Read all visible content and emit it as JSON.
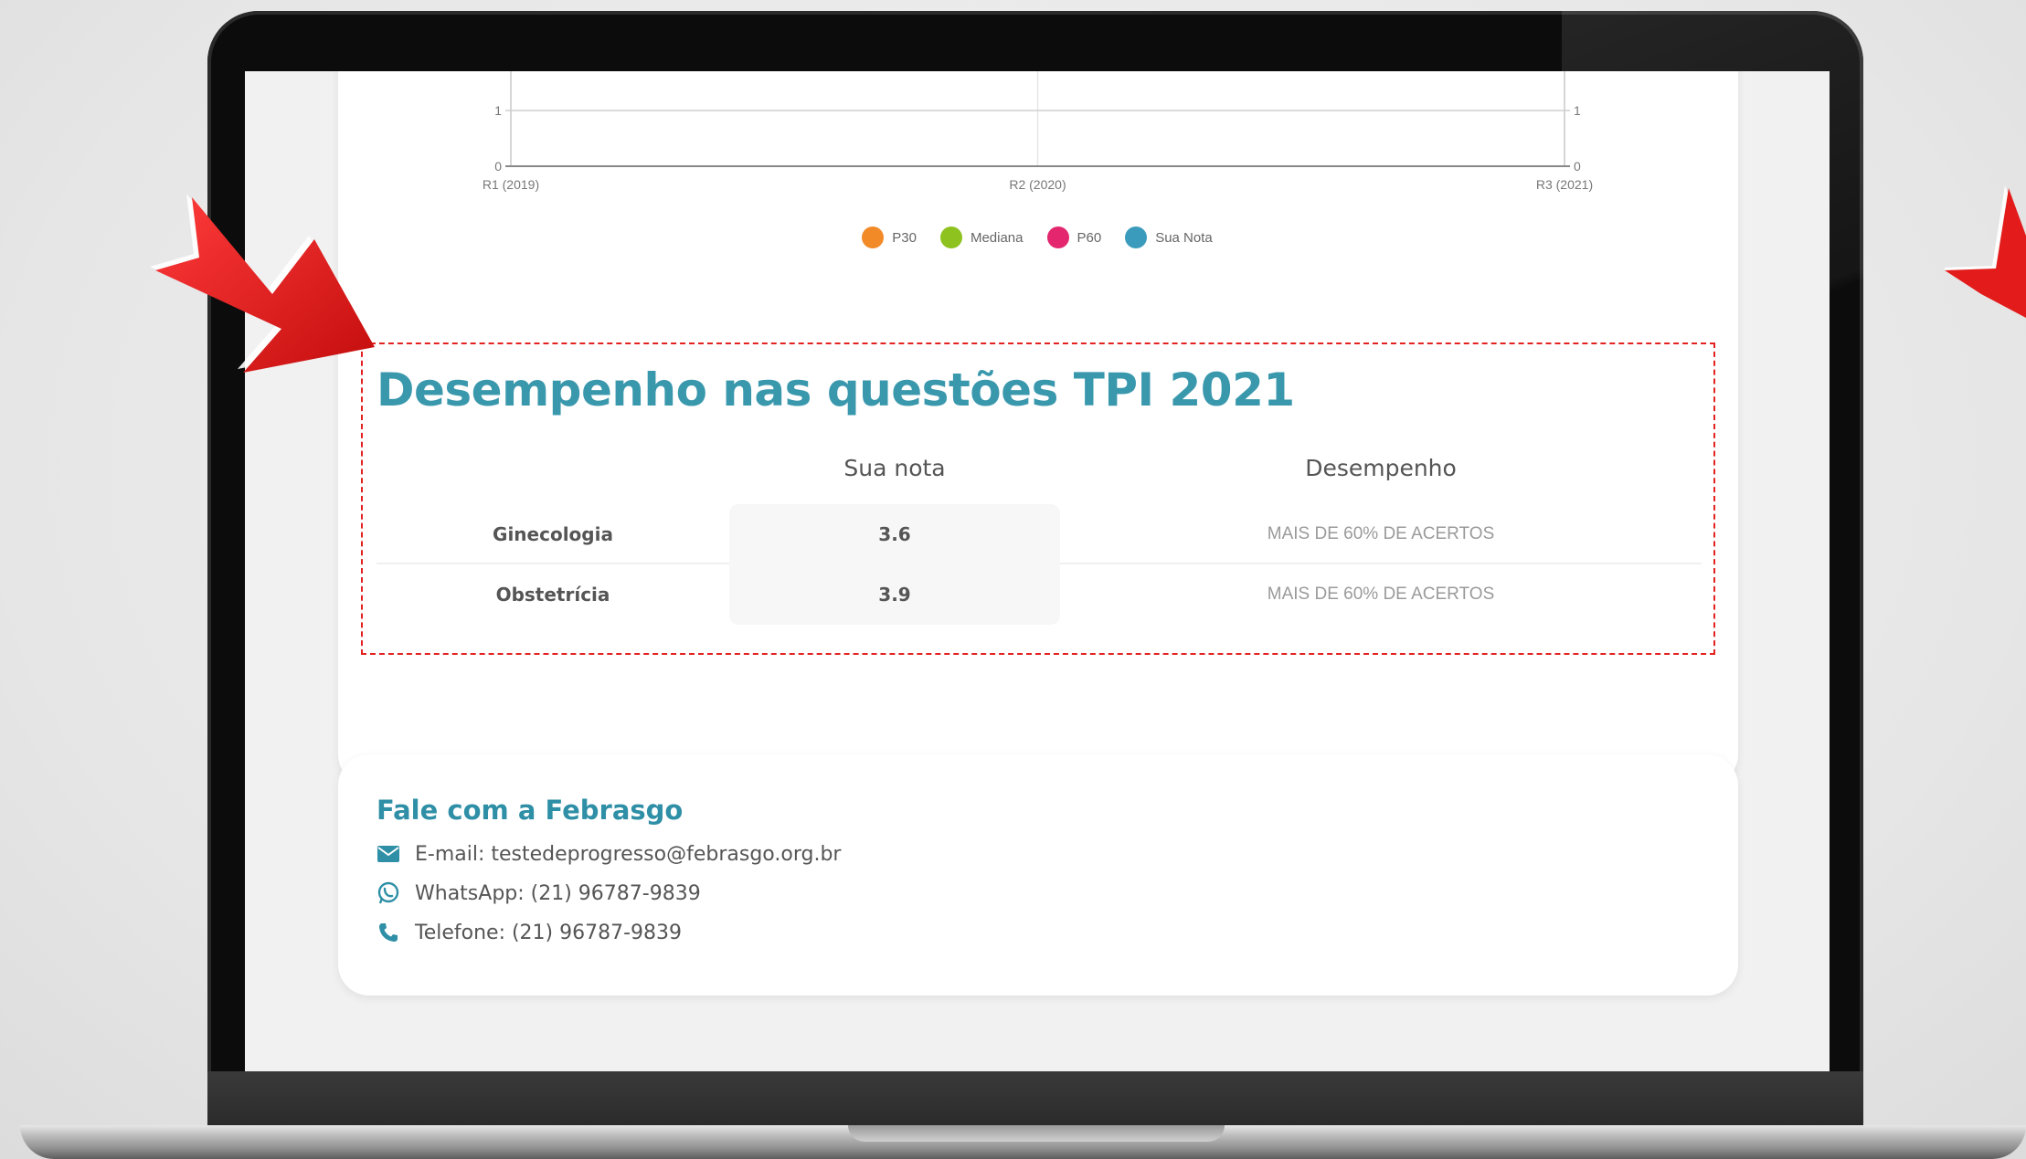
{
  "chart_data": {
    "type": "line",
    "categories": [
      "R1 (2019)",
      "R2 (2020)",
      "R3 (2021)"
    ],
    "y_ticks_left": [
      "0",
      "1"
    ],
    "y_ticks_right": [
      "0",
      "1"
    ],
    "ylim": [
      0,
      1
    ],
    "grid": true,
    "legend_position": "bottom-center",
    "series": [
      {
        "name": "P30",
        "color": "#f28a28",
        "values": []
      },
      {
        "name": "Mediana",
        "color": "#8dc21f",
        "values": []
      },
      {
        "name": "P60",
        "color": "#e3266d",
        "values": []
      },
      {
        "name": "Sua Nota",
        "color": "#3a9bbd",
        "values": []
      }
    ]
  },
  "performance": {
    "title": "Desempenho nas questões TPI 2021",
    "headers": {
      "score": "Sua nota",
      "performance": "Desempenho"
    },
    "rows": [
      {
        "subject": "Ginecologia",
        "score": "3.6",
        "performance": "MAIS DE 60% DE ACERTOS"
      },
      {
        "subject": "Obstetrícia",
        "score": "3.9",
        "performance": "MAIS DE 60% DE ACERTOS"
      }
    ]
  },
  "contact": {
    "title": "Fale com a Febrasgo",
    "email": "E-mail: testedeprogresso@febrasgo.org.br",
    "whatsapp": "WhatsApp: (21) 96787-9839",
    "phone": "Telefone: (21) 96787-9839",
    "icons": [
      "email-icon",
      "whatsapp-icon",
      "phone-icon"
    ]
  },
  "colors": {
    "accent": "#3a98ad",
    "highlight_border": "#e32121",
    "arrow": "#e31b1b"
  }
}
